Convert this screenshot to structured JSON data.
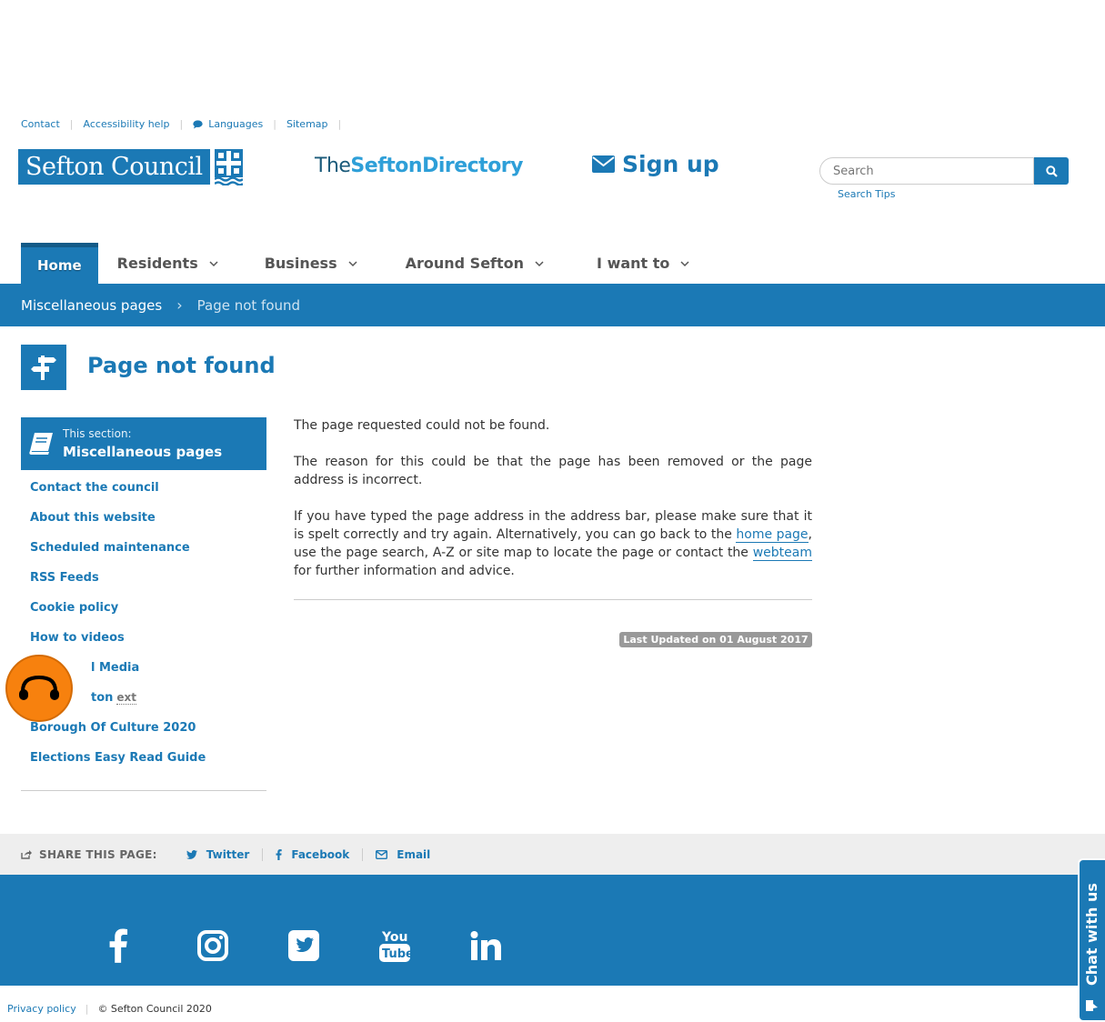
{
  "utility": {
    "contact": "Contact",
    "accessibility": "Accessibility help",
    "languages": "Languages",
    "sitemap": "Sitemap"
  },
  "logo": {
    "text": "Sefton Council"
  },
  "directory": {
    "the": "The",
    "sefton": "Sefton",
    "dir": "Directory"
  },
  "signup": {
    "label": "Sign up"
  },
  "search": {
    "placeholder": "Search",
    "tips": "Search Tips"
  },
  "nav": {
    "home": "Home",
    "residents": "Residents",
    "business": "Business",
    "around": "Around Sefton",
    "iwant": "I want to"
  },
  "breadcrumb": {
    "parent": "Miscellaneous pages",
    "current": "Page not found"
  },
  "page": {
    "title": "Page not found"
  },
  "sidebar": {
    "section_small": "This section:",
    "section_name": "Miscellaneous pages",
    "items": [
      {
        "label": "Contact the council"
      },
      {
        "label": "About this website"
      },
      {
        "label": "Scheduled maintenance"
      },
      {
        "label": "RSS Feeds"
      },
      {
        "label": "Cookie policy"
      },
      {
        "label": "How to videos"
      },
      {
        "label": "l Media"
      },
      {
        "label": "ton",
        "ext": "ext"
      },
      {
        "label": "Borough Of Culture 2020"
      },
      {
        "label": "Elections Easy Read Guide"
      }
    ]
  },
  "content": {
    "p1": "The page requested could not be found.",
    "p2": "The reason for this could be that the page has been removed or the page address is incorrect.",
    "p3_a": "If you have typed the page address in the address bar, please make sure that it is spelt correctly and try again. Alternatively, you can go back to the ",
    "p3_link1": "home page",
    "p3_b": ", use the page search, A-Z or site map to locate the page or contact the ",
    "p3_link2": "webteam",
    "p3_c": " for further information and advice.",
    "updated": "Last Updated on 01 August 2017"
  },
  "share": {
    "label": "SHARE THIS PAGE:",
    "twitter": "Twitter",
    "facebook": "Facebook",
    "email": "Email"
  },
  "footer": {
    "privacy": "Privacy policy",
    "copyright": "© Sefton Council 2020"
  },
  "chat": {
    "label": "Chat with us"
  },
  "colors": {
    "brand": "#1b79b5",
    "audio": "#f7810e"
  }
}
